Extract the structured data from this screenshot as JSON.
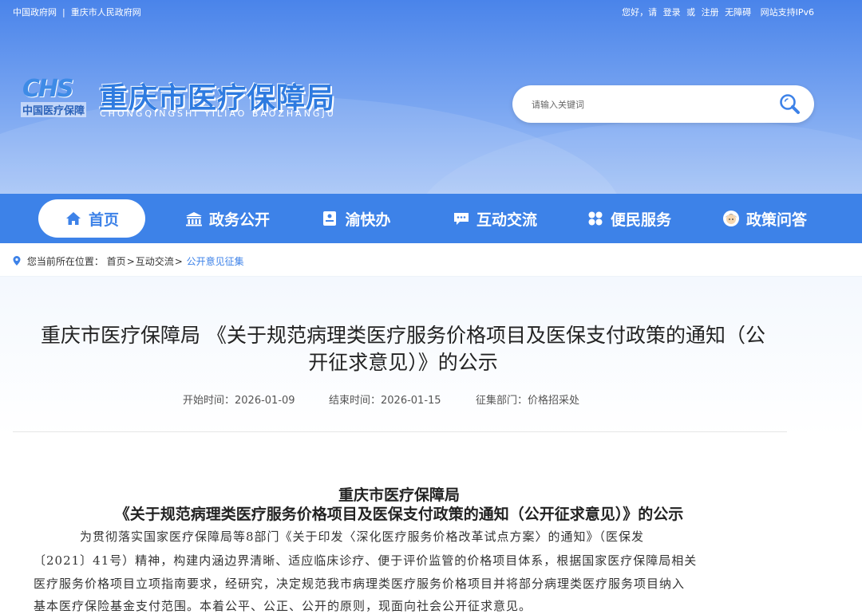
{
  "topbar": {
    "gov_link": "中国政府网",
    "city_link": "重庆市人民政府网",
    "greeting": "您好，请",
    "login": "登录",
    "or": "或",
    "register": "注册",
    "accessibility": "无障碍",
    "ipv6": "网站支持IPv6"
  },
  "logo": {
    "mark_text": "CHS",
    "mark_cn": "中国医疗保障",
    "title": "重庆市医疗保障局",
    "subtitle": "CHONGQINGSHI YILIAO BAOZHANGJU"
  },
  "search": {
    "placeholder": "请输入关键词"
  },
  "nav": {
    "items": [
      {
        "label": "首页",
        "icon": "home-icon"
      },
      {
        "label": "政务公开",
        "icon": "building-icon"
      },
      {
        "label": "渝快办",
        "icon": "document-icon"
      },
      {
        "label": "互动交流",
        "icon": "chat-icon"
      },
      {
        "label": "便民服务",
        "icon": "grid-icon"
      },
      {
        "label": "政策问答",
        "icon": "assistant-icon"
      }
    ],
    "active_color": "#3d82e8"
  },
  "breadcrumb": {
    "prefix": "您当前所在位置：",
    "items": [
      "首页",
      "互动交流",
      "公开意见征集"
    ],
    "sep": ">"
  },
  "article": {
    "title_line1": "重庆市医疗保障局 《关于规范病理类医疗服务价格项目及医保支付政策的通知（公",
    "title_line2": "开征求意见）》的公示",
    "start": "开始时间：2026-01-09",
    "end": "结束时间：2026-01-15",
    "dept": "征集部门：价格招采处"
  },
  "document": {
    "heading1": "重庆市医疗保障局",
    "heading2": "《关于规范病理类医疗服务价格项目及医保支付政策的通知（公开征求意见）》的公示",
    "lines": [
      "为贯彻落实国家医疗保障局等8部门《关于印发〈深化医疗服务价格改革试点方案〉的通知》（医保发",
      "〔2021〕41号）精神，构建内涵边界清晰、适应临床诊疗、便于评价监管的价格项目体系，根据国家医疗保障局相关",
      "医疗服务价格项目立项指南要求，经研究，决定规范我市病理类医疗服务价格项目并将部分病理类医疗服务项目纳入",
      "基本医疗保险基金支付范围。本着公平、公正、公开的原则，现面向社会公开征求意见。"
    ]
  }
}
